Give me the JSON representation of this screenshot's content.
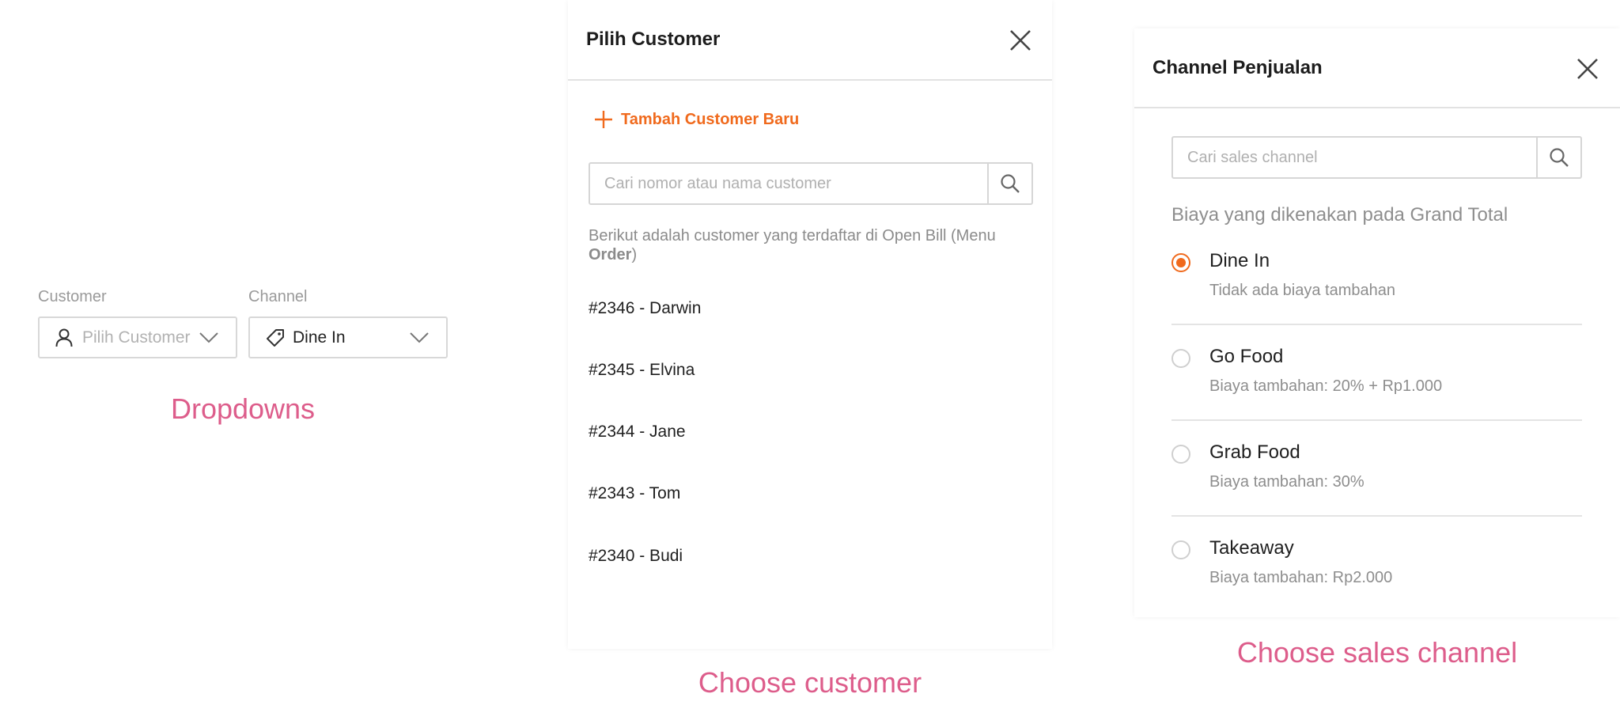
{
  "dropdowns_section": {
    "customer_label": "Customer",
    "customer_placeholder": "Pilih Customer",
    "channel_label": "Channel",
    "channel_value": "Dine In",
    "caption": "Dropdowns"
  },
  "customer_modal": {
    "title": "Pilih Customer",
    "add_button": "Tambah Customer Baru",
    "search_placeholder": "Cari nomor atau nama customer",
    "info_text_prefix": "Berikut adalah customer yang terdaftar di Open Bill (Menu ",
    "info_text_bold": "Order",
    "info_text_suffix": ")",
    "customers": [
      "#2346 - Darwin",
      "#2345 - Elvina",
      "#2344 - Jane",
      "#2343 - Tom",
      "#2340 - Budi"
    ],
    "caption": "Choose customer"
  },
  "channel_modal": {
    "title": "Channel Penjualan",
    "search_placeholder": "Cari sales channel",
    "subtitle": "Biaya yang dikenakan pada Grand Total",
    "options": [
      {
        "name": "Dine In",
        "desc": "Tidak ada biaya tambahan",
        "selected": true
      },
      {
        "name": "Go Food",
        "desc": "Biaya tambahan: 20% + Rp1.000",
        "selected": false
      },
      {
        "name": "Grab Food",
        "desc": "Biaya tambahan: 30%",
        "selected": false
      },
      {
        "name": "Takeaway",
        "desc": "Biaya tambahan: Rp2.000",
        "selected": false
      }
    ],
    "caption": "Choose sales channel"
  },
  "colors": {
    "accent": "#f06a1d",
    "caption": "#dd5d8b",
    "muted_text": "#8e8e8e"
  },
  "icons": {
    "customer_field": "user-icon",
    "channel_field": "tag-icon",
    "dropdown_arrow": "chevron-down-icon",
    "close": "close-icon",
    "add": "plus-icon",
    "search": "search-icon"
  }
}
